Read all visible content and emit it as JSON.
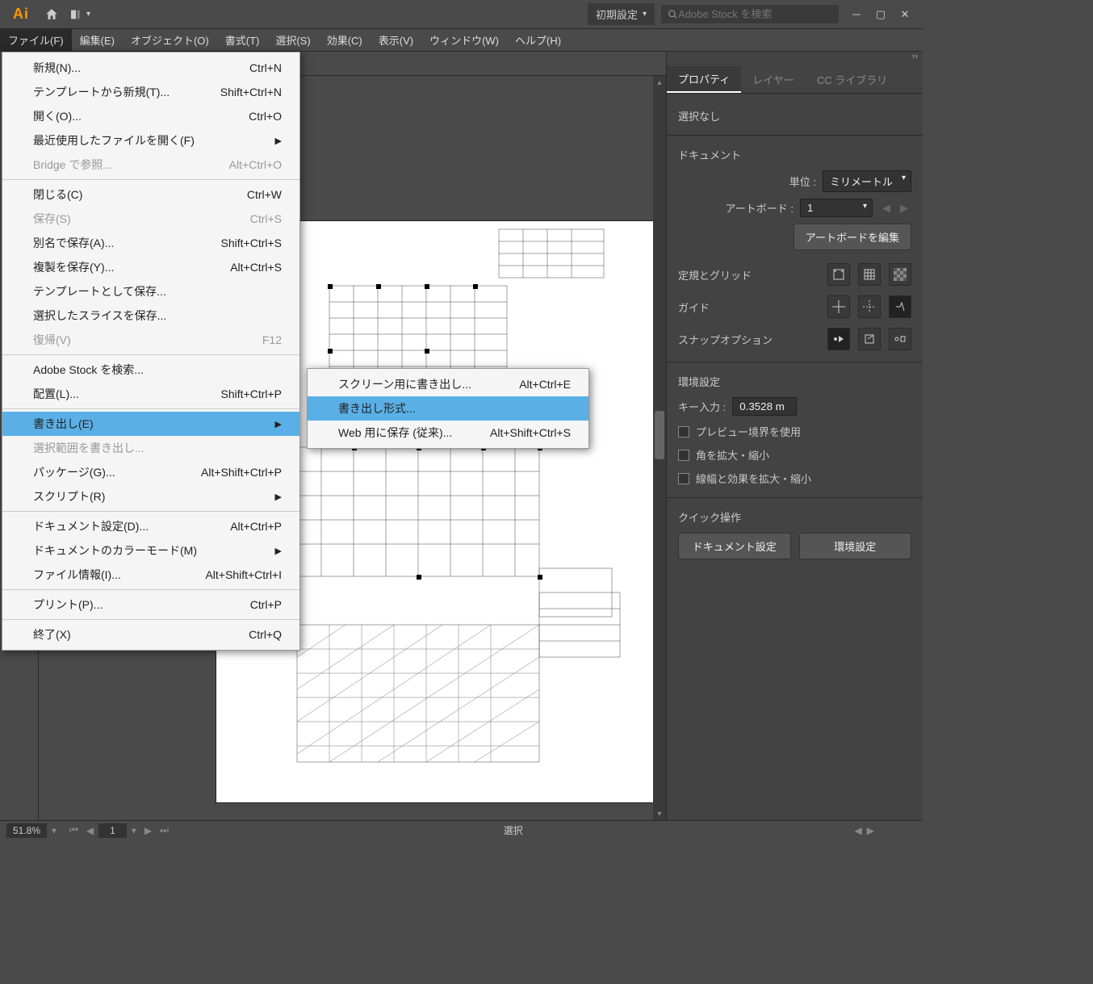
{
  "app_logo": "Ai",
  "workspace_dropdown": "初期設定",
  "search_placeholder": "Adobe Stock を検索",
  "menubar": [
    "ファイル(F)",
    "編集(E)",
    "オブジェクト(O)",
    "書式(T)",
    "選択(S)",
    "効果(C)",
    "表示(V)",
    "ウィンドウ(W)",
    "ヘルプ(H)"
  ],
  "file_menu": [
    {
      "label": "新規(N)...",
      "shortcut": "Ctrl+N"
    },
    {
      "label": "テンプレートから新規(T)...",
      "shortcut": "Shift+Ctrl+N"
    },
    {
      "label": "開く(O)...",
      "shortcut": "Ctrl+O"
    },
    {
      "label": "最近使用したファイルを開く(F)",
      "submenu": true
    },
    {
      "label": "Bridge で参照...",
      "shortcut": "Alt+Ctrl+O",
      "disabled": true
    },
    {
      "sep": true
    },
    {
      "label": "閉じる(C)",
      "shortcut": "Ctrl+W"
    },
    {
      "label": "保存(S)",
      "shortcut": "Ctrl+S",
      "disabled": true
    },
    {
      "label": "別名で保存(A)...",
      "shortcut": "Shift+Ctrl+S"
    },
    {
      "label": "複製を保存(Y)...",
      "shortcut": "Alt+Ctrl+S"
    },
    {
      "label": "テンプレートとして保存..."
    },
    {
      "label": "選択したスライスを保存..."
    },
    {
      "label": "復帰(V)",
      "shortcut": "F12",
      "disabled": true
    },
    {
      "sep": true
    },
    {
      "label": "Adobe Stock を検索..."
    },
    {
      "label": "配置(L)...",
      "shortcut": "Shift+Ctrl+P"
    },
    {
      "sep": true
    },
    {
      "label": "書き出し(E)",
      "highlighted": true,
      "submenu": true
    },
    {
      "label": "選択範囲を書き出し...",
      "disabled": true
    },
    {
      "label": "パッケージ(G)...",
      "shortcut": "Alt+Shift+Ctrl+P"
    },
    {
      "label": "スクリプト(R)",
      "submenu": true
    },
    {
      "sep": true
    },
    {
      "label": "ドキュメント設定(D)...",
      "shortcut": "Alt+Ctrl+P"
    },
    {
      "label": "ドキュメントのカラーモード(M)",
      "submenu": true
    },
    {
      "label": "ファイル情報(I)...",
      "shortcut": "Alt+Shift+Ctrl+I"
    },
    {
      "sep": true
    },
    {
      "label": "プリント(P)...",
      "shortcut": "Ctrl+P"
    },
    {
      "sep": true
    },
    {
      "label": "終了(X)",
      "shortcut": "Ctrl+Q"
    }
  ],
  "export_submenu": [
    {
      "label": "スクリーン用に書き出し...",
      "shortcut": "Alt+Ctrl+E"
    },
    {
      "label": "書き出し形式...",
      "highlighted": true
    },
    {
      "label": "Web 用に保存 (従来)...",
      "shortcut": "Alt+Shift+Ctrl+S"
    }
  ],
  "panel_tabs": [
    "プロパティ",
    "レイヤー",
    "CC ライブラリ"
  ],
  "props": {
    "selection": "選択なし",
    "doc_section": "ドキュメント",
    "unit_label": "単位 :",
    "unit_value": "ミリメートル",
    "artboard_label": "アートボード :",
    "artboard_value": "1",
    "edit_artboard_btn": "アートボードを編集",
    "ruler_grid": "定規とグリッド",
    "guide": "ガイド",
    "snap": "スナップオプション",
    "prefs_section": "環境設定",
    "key_input_label": "キー入力 :",
    "key_input_value": "0.3528 m",
    "cb_preview": "プレビュー境界を使用",
    "cb_scale_corner": "角を拡大・縮小",
    "cb_scale_stroke": "線幅と効果を拡大・縮小",
    "quick_section": "クイック操作",
    "btn_doc_settings": "ドキュメント設定",
    "btn_prefs": "環境設定"
  },
  "status": {
    "zoom": "51.8%",
    "page": "1",
    "mode": "選択"
  }
}
